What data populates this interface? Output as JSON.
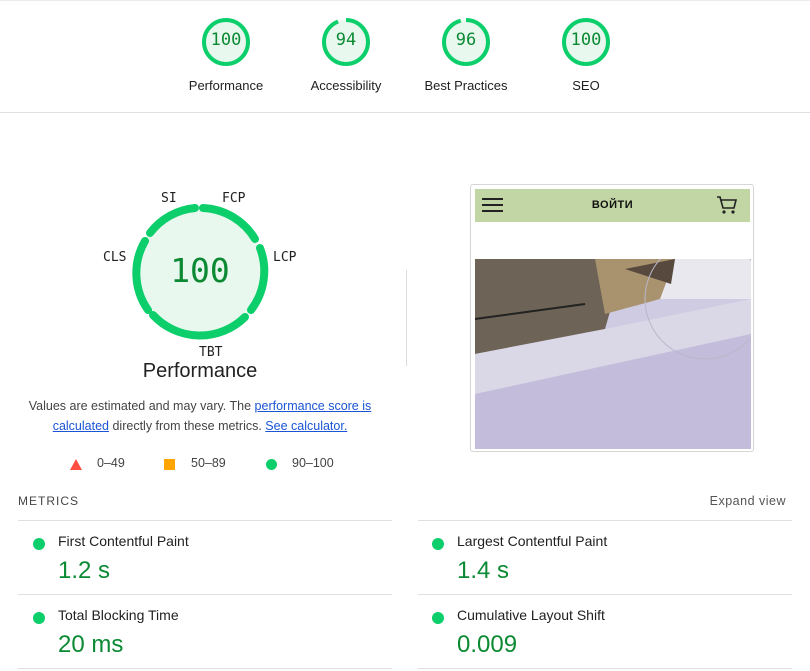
{
  "scores": [
    {
      "label": "Performance",
      "value": "100",
      "fraction": 1.0
    },
    {
      "label": "Accessibility",
      "value": "94",
      "fraction": 0.94
    },
    {
      "label": "Best Practices",
      "value": "96",
      "fraction": 0.96
    },
    {
      "label": "SEO",
      "value": "100",
      "fraction": 1.0
    }
  ],
  "performance": {
    "score": "100",
    "title": "Performance",
    "tags": {
      "si": "SI",
      "fcp": "FCP",
      "lcp": "LCP",
      "tbt": "TBT",
      "cls": "CLS"
    }
  },
  "note": {
    "prefix": "Values are estimated and may vary. The ",
    "link1": "performance score is calculated",
    "middle": " directly from these metrics. ",
    "link2": "See calculator."
  },
  "legend": {
    "fail": "0–49",
    "average": "50–89",
    "pass": "90–100"
  },
  "thumbnail": {
    "login_label": "ВОЙТИ"
  },
  "metrics": {
    "heading": "METRICS",
    "expand_label": "Expand view",
    "items": [
      {
        "name": "First Contentful Paint",
        "value": "1.2 s"
      },
      {
        "name": "Largest Contentful Paint",
        "value": "1.4 s"
      },
      {
        "name": "Total Blocking Time",
        "value": "20 ms"
      },
      {
        "name": "Cumulative Layout Shift",
        "value": "0.009"
      }
    ]
  },
  "colors": {
    "pass": "#0cce6b",
    "pass_text": "#0b8a33",
    "average": "#ffa400",
    "fail": "#ff4e42",
    "link": "#1a55d4",
    "thumb_header": "#c1d6a4"
  }
}
